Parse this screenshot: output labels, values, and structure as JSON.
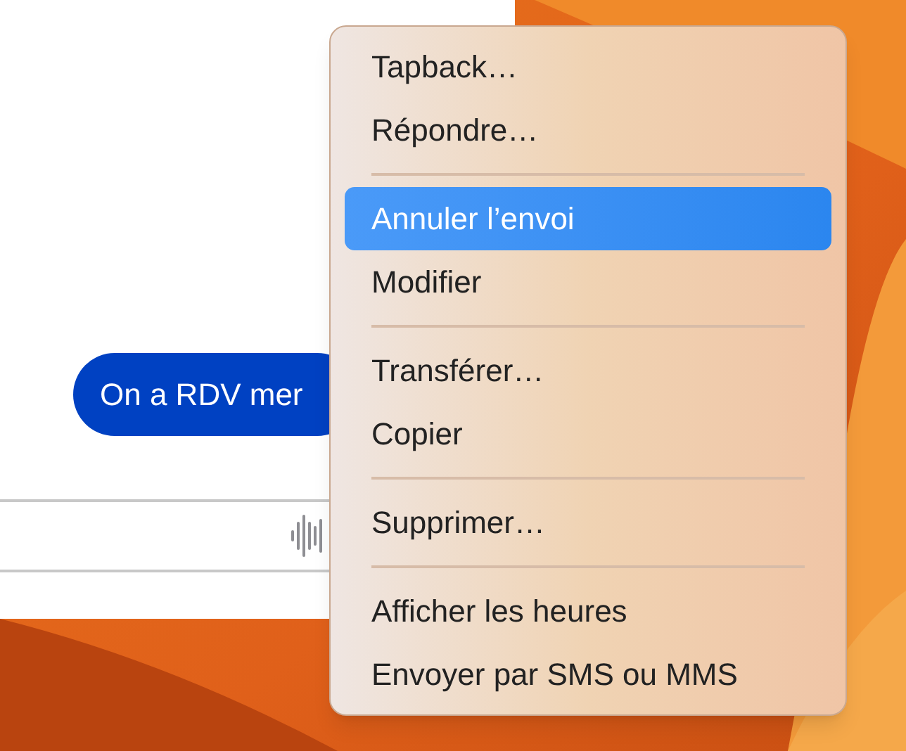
{
  "conversation": {
    "messages": [
      {
        "text": "On a RDV mer",
        "sent": true
      }
    ]
  },
  "composer": {
    "kind": "audio"
  },
  "context_menu": {
    "sections": [
      [
        {
          "label": "Tapback…",
          "selected": false
        },
        {
          "label": "Répondre…",
          "selected": false
        }
      ],
      [
        {
          "label": "Annuler l’envoi",
          "selected": true
        },
        {
          "label": "Modifier",
          "selected": false
        }
      ],
      [
        {
          "label": "Transférer…",
          "selected": false
        },
        {
          "label": "Copier",
          "selected": false
        }
      ],
      [
        {
          "label": "Supprimer…",
          "selected": false
        }
      ],
      [
        {
          "label": "Afficher les heures",
          "selected": false
        },
        {
          "label": "Envoyer par SMS ou MMS",
          "selected": false
        }
      ]
    ]
  }
}
